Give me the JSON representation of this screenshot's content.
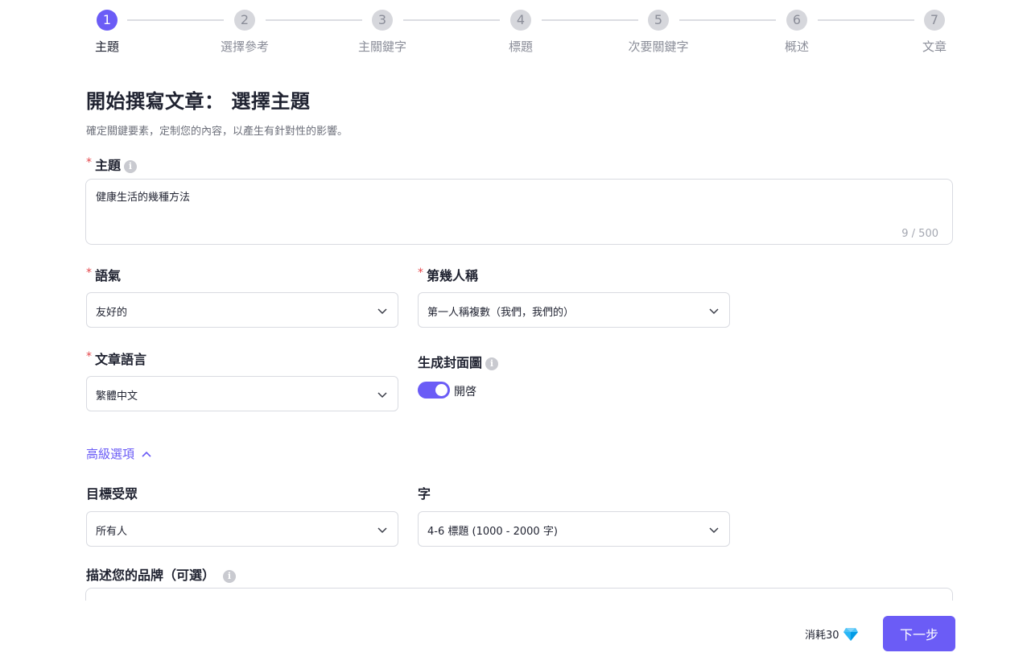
{
  "stepper": {
    "steps": [
      {
        "number": "1",
        "label": "主題"
      },
      {
        "number": "2",
        "label": "選擇參考"
      },
      {
        "number": "3",
        "label": "主關鍵字"
      },
      {
        "number": "4",
        "label": "標題"
      },
      {
        "number": "5",
        "label": "次要關鍵字"
      },
      {
        "number": "6",
        "label": "概述"
      },
      {
        "number": "7",
        "label": "文章"
      }
    ],
    "active_step": 1
  },
  "header": {
    "title": "開始撰寫文章：  選擇主題",
    "subtitle": "確定關鍵要素，定制您的內容，以產生有針對性的影響。"
  },
  "form": {
    "topic": {
      "label": "主題",
      "required_mark": "*",
      "value": "健康生活的幾種方法",
      "count": "9 / 500"
    },
    "tone": {
      "label": "語氣",
      "required_mark": "*",
      "value": "友好的"
    },
    "person": {
      "label": "第幾人稱",
      "required_mark": "*",
      "value": "第一人稱複數（我們，我們的）"
    },
    "language": {
      "label": "文章語言",
      "required_mark": "*",
      "value": "繁體中文"
    },
    "cover": {
      "label": "生成封面圖",
      "toggle_label": "開啓",
      "enabled": true
    },
    "advanced": {
      "label": "高級選項"
    },
    "audience": {
      "label": "目標受眾",
      "value": "所有人"
    },
    "length": {
      "label": "字",
      "value": "4-6 標題 (1000 - 2000 字)"
    },
    "brand": {
      "label": "描述您的品牌（可選）",
      "placeholder": ""
    }
  },
  "footer": {
    "cost_label": "消耗30",
    "next_label": "下一步"
  },
  "colors": {
    "accent": "#6b5cf6",
    "required": "#e5484d",
    "muted": "#8b8e99"
  },
  "icons": {
    "info": "info-icon",
    "chevron": "chevron-down-icon",
    "advanced": "chevron-up-icon",
    "cost": "diamond-icon"
  }
}
